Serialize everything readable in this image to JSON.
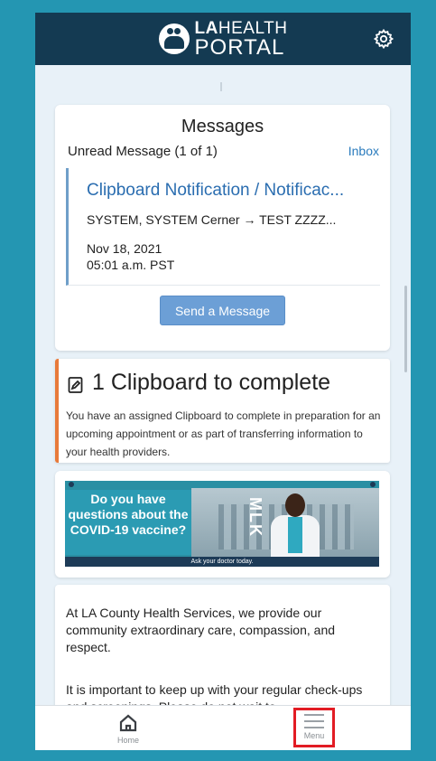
{
  "header": {
    "logo_line1_bold": "LA",
    "logo_line1_rest": "HEALTH",
    "logo_line2": "PORTAL",
    "settings_icon": "gear-icon"
  },
  "messages": {
    "title": "Messages",
    "unread_label": "Unread Message (1 of 1)",
    "inbox_link": "Inbox",
    "item": {
      "subject": "Clipboard Notification / Notificac...",
      "from_to": "SYSTEM, SYSTEM Cerner → TEST ZZZZ...",
      "date": "Nov 18, 2021",
      "time": "05:01 a.m. PST"
    },
    "send_button": "Send a Message"
  },
  "clipboard": {
    "heading": "1 Clipboard to complete",
    "text": "You have an assigned Clipboard to complete in preparation for an upcoming appointment or as part of transferring information to your health providers.",
    "accent_color": "#e87a3a"
  },
  "banner": {
    "question": "Do you have questions about the COVID-19 vaccine?",
    "building_text": "MLK",
    "footer": "Ask your doctor today."
  },
  "info": {
    "paragraph1": "At LA County Health Services, we provide our community extraordinary care, compassion, and respect.",
    "paragraph2": "It is important to keep up with your regular check-ups and screenings. Please do not wait to"
  },
  "nav": {
    "home_label": "Home",
    "menu_label": "Menu",
    "highlight_color": "#e21c24"
  }
}
